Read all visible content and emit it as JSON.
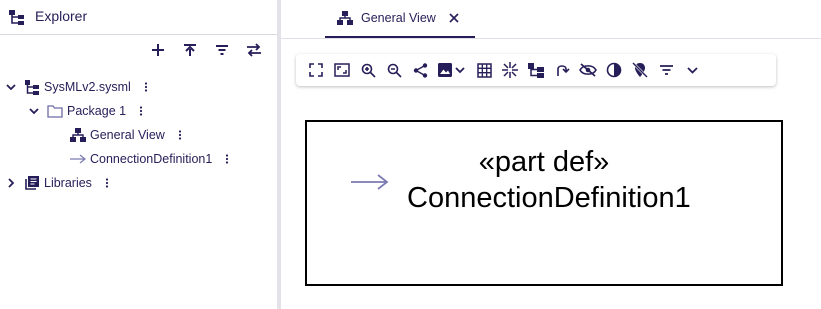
{
  "explorer": {
    "title": "Explorer",
    "toolbar": [
      {
        "name": "new-model-button",
        "icon": "plus-icon"
      },
      {
        "name": "upload-button",
        "icon": "upload-icon"
      },
      {
        "name": "filter-button",
        "icon": "filter-icon"
      },
      {
        "name": "sync-button",
        "icon": "swap-icon"
      }
    ],
    "tree": [
      {
        "label": "SysMLv2.sysml",
        "icon": "model-tree-icon",
        "expanded": true,
        "level": 0
      },
      {
        "label": "Package 1",
        "icon": "folder-icon",
        "expanded": true,
        "level": 1
      },
      {
        "label": "General View",
        "icon": "diagram-icon",
        "level": 2
      },
      {
        "label": "ConnectionDefinition1",
        "icon": "connection-arrow-icon",
        "level": 2
      },
      {
        "label": "Libraries",
        "icon": "library-icon",
        "expanded": false,
        "level": 0
      }
    ]
  },
  "editor": {
    "tab": {
      "label": "General View",
      "icon": "diagram-icon"
    },
    "toolbar": [
      "fit-to-screen-icon",
      "fullscreen-icon",
      "zoom-in-icon",
      "zoom-out-icon",
      "share-icon",
      "export-image-icon",
      "grid-icon",
      "collapse-icon",
      "arrange-icon",
      "redo-arrow-icon",
      "hide-icon",
      "contrast-icon",
      "pin-off-icon",
      "filter-icon",
      "chevron-down-icon"
    ],
    "node": {
      "stereotype": "«part def»",
      "name": "ConnectionDefinition1"
    }
  },
  "colors": {
    "ink": "#261e58",
    "connection": "#7a7ab2",
    "border": "#000000"
  }
}
